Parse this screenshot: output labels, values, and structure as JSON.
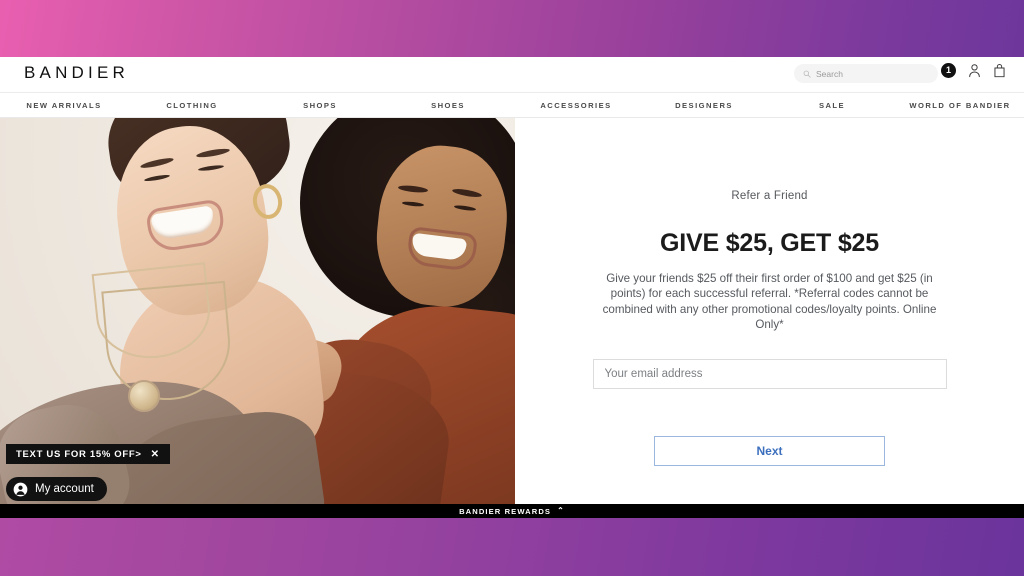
{
  "theme": {
    "gradient_left": "#e95fb0",
    "gradient_right": "#65349a",
    "accent_blue": "#3c6fbd",
    "black": "#000000"
  },
  "header": {
    "brand": "BANDIER",
    "search": {
      "placeholder": "Search",
      "value": "",
      "icon": "search-icon"
    },
    "icons": [
      {
        "name": "notification-badge",
        "label": "1"
      },
      {
        "name": "account-icon",
        "label": ""
      },
      {
        "name": "bag-icon",
        "label": ""
      }
    ]
  },
  "nav": {
    "items": [
      {
        "label": "NEW ARRIVALS"
      },
      {
        "label": "CLOTHING"
      },
      {
        "label": "SHOPS"
      },
      {
        "label": "SHOES"
      },
      {
        "label": "ACCESSORIES"
      },
      {
        "label": "DESIGNERS"
      },
      {
        "label": "SALE"
      },
      {
        "label": "WORLD OF BANDIER"
      }
    ]
  },
  "hero": {
    "alt": "Two women laughing together wearing knit sweaters",
    "text_us_banner": {
      "label": "TEXT US FOR 15% OFF>",
      "close": "✕"
    },
    "account_chip": {
      "label": "My account",
      "icon": "user-circle-icon"
    }
  },
  "refer": {
    "eyebrow": "Refer a Friend",
    "headline": "GIVE $25, GET $25",
    "description": "Give your friends $25 off their first order of $100 and get $25 (in points) for each successful referral. *Referral codes cannot be combined with any other promotional codes/loyalty points. Online Only*",
    "email": {
      "placeholder": "Your email address",
      "value": ""
    },
    "next_label": "Next"
  },
  "footer": {
    "rewards_label": "BANDIER REWARDS",
    "chevron": "⌃"
  }
}
